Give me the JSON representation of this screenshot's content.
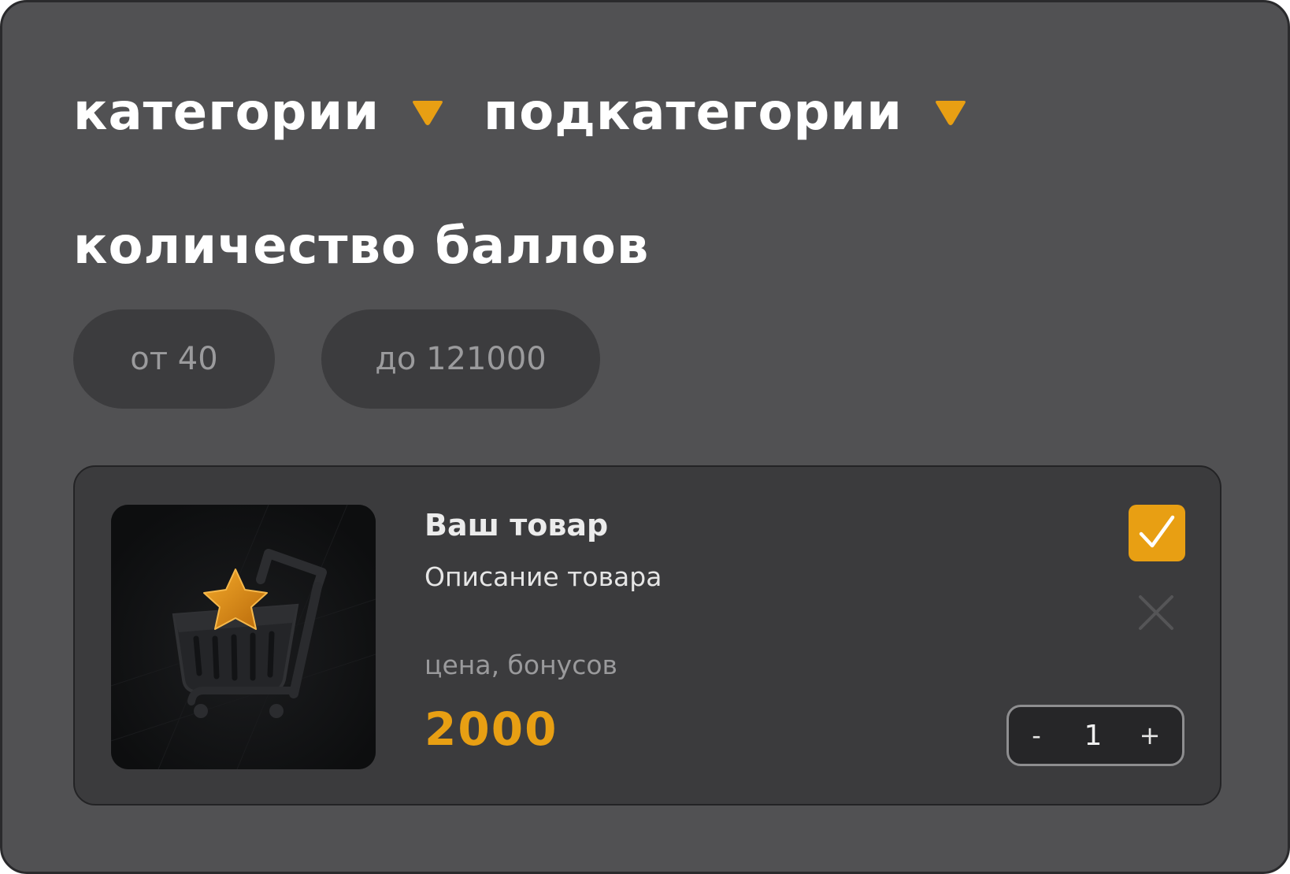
{
  "filters": {
    "category_label": "категории",
    "subcategory_label": "подкатегории"
  },
  "points": {
    "title": "количество баллов",
    "from_placeholder": "от 40",
    "to_placeholder": "до 121000"
  },
  "product": {
    "name": "Ваш товар",
    "description": "Описание товара",
    "price_label": "цена, бонусов",
    "price": "2000",
    "selected": true,
    "quantity": "1",
    "decrement_label": "-",
    "increment_label": "+"
  },
  "colors": {
    "accent": "#e89f13",
    "panel_bg": "#515153",
    "card_bg": "#3b3b3d"
  },
  "icons": {
    "dropdown": "triangle-down-icon",
    "check": "check-icon",
    "remove": "close-icon",
    "product": "cart-with-star-icon"
  }
}
